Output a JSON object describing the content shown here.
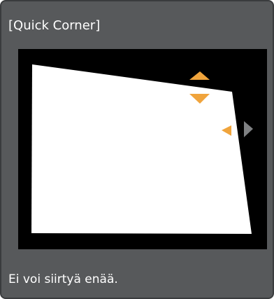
{
  "dialog": {
    "title": "[Quick Corner]",
    "message": "Ei voi siirtyä enää."
  },
  "icons": {
    "arrow_up": "arrow-up-icon",
    "arrow_down": "arrow-down-icon",
    "arrow_left": "arrow-left-icon",
    "arrow_right": "arrow-right-icon"
  },
  "colors": {
    "panel_background": "#57595b",
    "panel_border": "#3a3c3e",
    "preview_background": "#000000",
    "shape_fill": "#ffffff",
    "arrow_active": "#f0a43c",
    "arrow_inactive": "#7f8183",
    "text": "#ffffff"
  }
}
